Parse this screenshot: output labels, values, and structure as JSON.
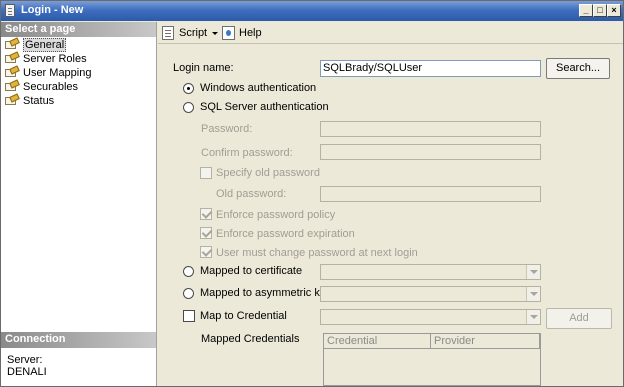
{
  "window": {
    "title": "Login - New"
  },
  "left_panel": {
    "select_page_header": "Select a page",
    "pages": [
      {
        "label": "General",
        "selected": true
      },
      {
        "label": "Server Roles",
        "selected": false
      },
      {
        "label": "User Mapping",
        "selected": false
      },
      {
        "label": "Securables",
        "selected": false
      },
      {
        "label": "Status",
        "selected": false
      }
    ],
    "connection_header": "Connection",
    "server_label": "Server:",
    "server_value": "DENALI"
  },
  "toolbar": {
    "script_label": "Script",
    "help_label": "Help"
  },
  "form": {
    "login_name_label": "Login name:",
    "login_name_value": "SQLBrady/SQLUser",
    "search_button": "Search...",
    "windows_auth_label": "Windows authentication",
    "sql_auth_label": "SQL Server authentication",
    "password_label": "Password:",
    "confirm_password_label": "Confirm password:",
    "specify_old_password_label": "Specify old password",
    "old_password_label": "Old password:",
    "enforce_policy_label": "Enforce password policy",
    "enforce_expiration_label": "Enforce password expiration",
    "must_change_label": "User must change password at next login",
    "mapped_cert_label": "Mapped to certificate",
    "mapped_asym_label": "Mapped to asymmetric key",
    "map_credential_label": "Map to Credential",
    "add_button": "Add",
    "mapped_credentials_label": "Mapped Credentials",
    "grid_columns": [
      "Credential",
      "Provider"
    ]
  }
}
